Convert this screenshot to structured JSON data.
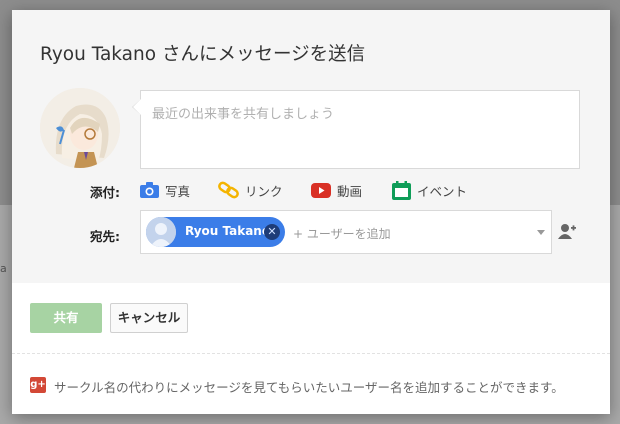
{
  "dialog": {
    "title": "Ryou Takano さんにメッセージを送信",
    "share_placeholder": "最近の出来事を共有しましょう",
    "attach_label": "添付:",
    "attachments": [
      {
        "label": "写真",
        "icon": "camera-icon"
      },
      {
        "label": "リンク",
        "icon": "link-icon"
      },
      {
        "label": "動画",
        "icon": "video-icon"
      },
      {
        "label": "イベント",
        "icon": "calendar-icon"
      }
    ],
    "to_label": "宛先:",
    "recipient": {
      "name": "Ryou Takano",
      "remove_glyph": "✕"
    },
    "add_user_placeholder": "+ ユーザーを追加",
    "share_button": "共有",
    "cancel_button": "キャンセル",
    "footer_text": "サークル名の代わりにメッセージを見てもらいたいユーザー名を追加することができます。",
    "gplus_glyph": "g+"
  },
  "backdrop_fragment": "a",
  "colors": {
    "share_button": "#a7d3a3",
    "chip": "#3b7de8",
    "camera": "#3b7de8",
    "link": "#f4b400",
    "video": "#d93025",
    "calendar": "#0f9d58",
    "gplus": "#d34836"
  }
}
